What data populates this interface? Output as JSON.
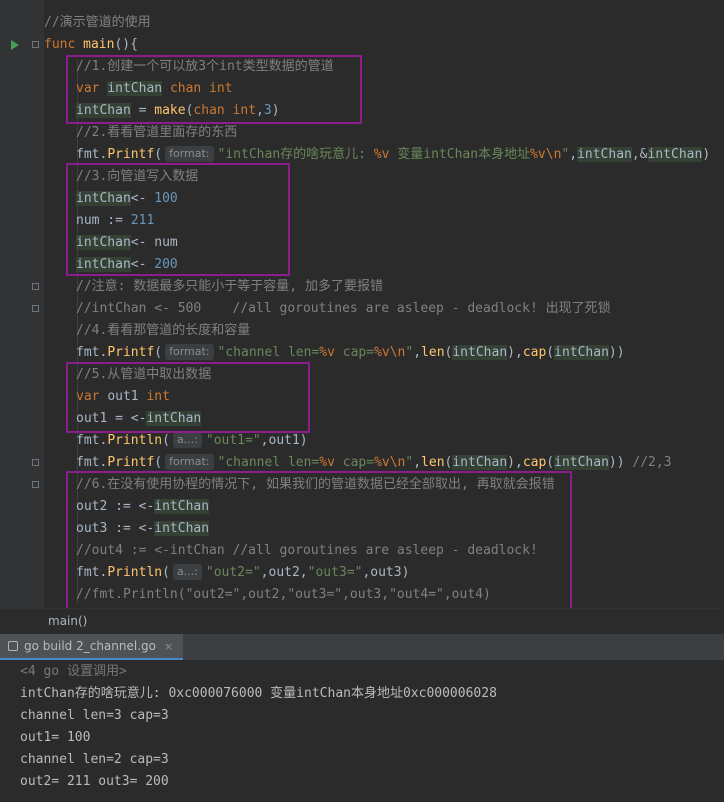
{
  "editor": {
    "lines": [
      {
        "t": "//演示管道的使用"
      },
      {
        "t": "func main(){"
      },
      {
        "t": "//1.创建一个可以放3个int类型数据的管道"
      },
      {
        "t": "var intChan chan int"
      },
      {
        "t": "intChan = make(chan int,3)"
      },
      {
        "t": "//2.看看管道里面存的东西"
      },
      {
        "t": "fmt.Printf( format: \"intChan存的啥玩意儿: %v 变量intChan本身地址%v\\n\",intChan,&intChan)"
      },
      {
        "t": "//3.向管道写入数据"
      },
      {
        "t": "intChan<- 100"
      },
      {
        "t": "num := 211"
      },
      {
        "t": "intChan<- num"
      },
      {
        "t": "intChan<- 200"
      },
      {
        "t": "//注意: 数据最多只能小于等于容量, 加多了要报错"
      },
      {
        "t": "//intChan <- 500    //all goroutines are asleep - deadlock! 出现了死锁"
      },
      {
        "t": "//4.看看那管道的长度和容量"
      },
      {
        "t": "fmt.Printf( format: \"channel len=%v cap=%v\\n\",len(intChan),cap(intChan))"
      },
      {
        "t": "//5.从管道中取出数据"
      },
      {
        "t": "var out1 int"
      },
      {
        "t": "out1 = <-intChan"
      },
      {
        "t": "fmt.Println( a...: \"out1=\",out1)"
      },
      {
        "t": "fmt.Printf( format: \"channel len=%v cap=%v\\n\",len(intChan),cap(intChan)) //2,3"
      },
      {
        "t": "//6.在没有使用协程的情况下, 如果我们的管道数据已经全部取出, 再取就会报错"
      },
      {
        "t": "out2 := <-intChan"
      },
      {
        "t": "out3 := <-intChan"
      },
      {
        "t": "//out4 := <-intChan //all goroutines are asleep - deadlock!"
      },
      {
        "t": "fmt.Println( a...: \"out2=\",out2,\"out3=\",out3)"
      },
      {
        "t": "//fmt.Println(\"out2=\",out2,\"out3=\",out3,\"out4=\",out4)"
      }
    ]
  },
  "breadcrumb": "main()",
  "run_tab": {
    "label": "go build 2_channel.go",
    "close": "×"
  },
  "console": {
    "lines": [
      "<4 go 设置调用>",
      "intChan存的啥玩意儿: 0xc000076000 变量intChan本身地址0xc000006028",
      "channel len=3 cap=3",
      "out1= 100",
      "channel len=2 cap=3",
      "out2= 211 out3= 200"
    ]
  },
  "colors": {
    "highlight_box": "#8b1d8d",
    "background": "#2b2b2b"
  }
}
